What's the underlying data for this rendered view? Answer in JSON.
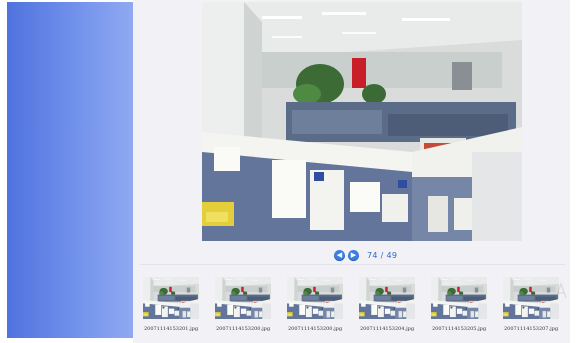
{
  "viewer": {
    "prev_icon": "chevron-left-icon",
    "next_icon": "chevron-right-icon",
    "counter": "74 / 49"
  },
  "thumbnails": [
    {
      "label": "20071114153201.jpg"
    },
    {
      "label": "20071114153200.jpg"
    },
    {
      "label": "20071114153200.jpg"
    },
    {
      "label": "20071114153204.jpg"
    },
    {
      "label": "20071114153205.jpg"
    },
    {
      "label": "20071114153207.jpg"
    }
  ],
  "colors": {
    "sidebar": "#5a7ee4",
    "content_bg": "#f1f1f6",
    "nav_button": "#3d7fe0"
  }
}
